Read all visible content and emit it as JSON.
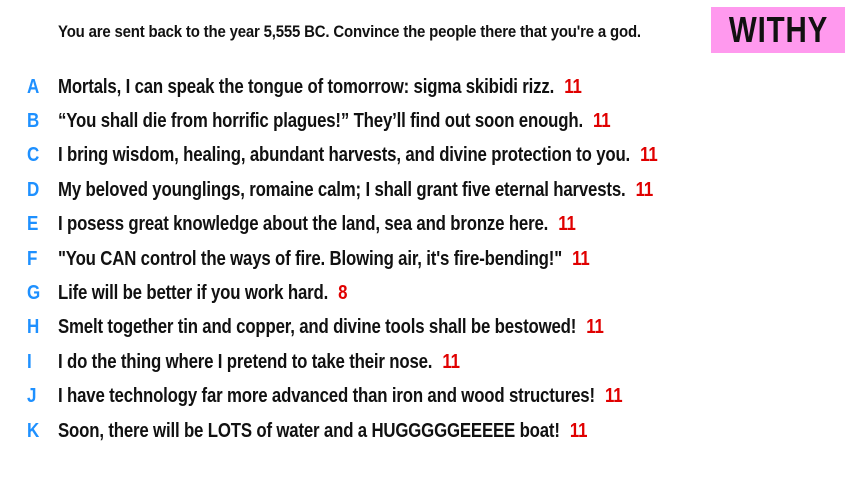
{
  "prompt": "You are sent back to the year 5,555 BC. Convince the people there that you're a god.",
  "player": {
    "name": "WITHY"
  },
  "colors": {
    "letter": "#1e90ff",
    "score": "#e00000",
    "badge_background": "#ff99ee",
    "text": "#111111"
  },
  "answers": [
    {
      "letter": "A",
      "text": "Mortals, I can speak the tongue of tomorrow: sigma skibidi rizz.",
      "score": "11"
    },
    {
      "letter": "B",
      "text": "“You shall die from horrific plagues!” They’ll find out soon enough.",
      "score": "11"
    },
    {
      "letter": "C",
      "text": "I bring wisdom, healing, abundant harvests, and divine protection to you.",
      "score": "11"
    },
    {
      "letter": "D",
      "text": "My beloved younglings, romaine calm; I shall grant five eternal harvests.",
      "score": "11"
    },
    {
      "letter": "E",
      "text": "I posess great knowledge about the land, sea and bronze here.",
      "score": "11"
    },
    {
      "letter": "F",
      "text": "\"You CAN control the ways of fire. Blowing air, it's fire-bending!\"",
      "score": "11"
    },
    {
      "letter": "G",
      "text": "Life will be better if you work hard.",
      "score": "8"
    },
    {
      "letter": "H",
      "text": "Smelt together tin and copper, and divine tools shall be bestowed!",
      "score": "11"
    },
    {
      "letter": "I",
      "text": "I do the thing where I pretend to take their nose.",
      "score": "11"
    },
    {
      "letter": "J",
      "text": "I have technology far more advanced than iron and wood structures!",
      "score": "11"
    },
    {
      "letter": "K",
      "text": "Soon, there will be LOTS of water and a HUGGGGGEEEEE boat!",
      "score": "11"
    }
  ]
}
